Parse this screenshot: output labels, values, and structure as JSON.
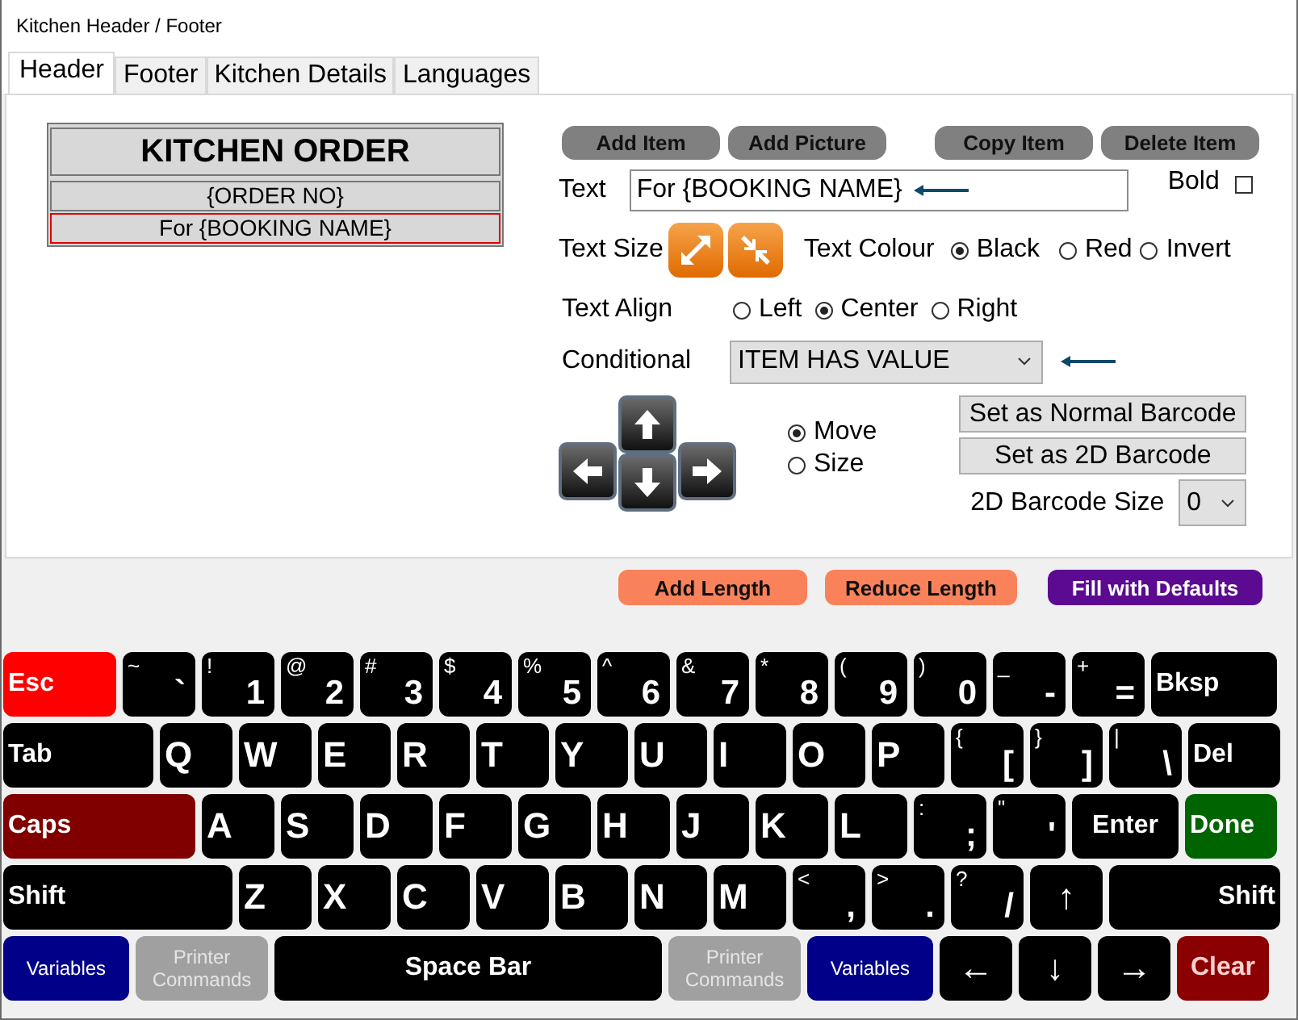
{
  "window": {
    "title": "Kitchen Header / Footer"
  },
  "tabs": [
    {
      "label": "Header",
      "selected": true
    },
    {
      "label": "Footer",
      "selected": false
    },
    {
      "label": "Kitchen Details",
      "selected": false
    },
    {
      "label": "Languages",
      "selected": false
    }
  ],
  "preview": {
    "lines": [
      {
        "text": "KITCHEN ORDER",
        "bold": true,
        "selected": false
      },
      {
        "text": "{ORDER NO}",
        "bold": false,
        "selected": false
      },
      {
        "text": "For {BOOKING NAME}",
        "bold": false,
        "selected": true
      }
    ]
  },
  "toolbar_buttons": [
    "Add Item",
    "Add Picture",
    "Copy Item",
    "Delete Item"
  ],
  "text_field": {
    "label": "Text",
    "value": "For {BOOKING NAME}"
  },
  "bold": {
    "label": "Bold",
    "checked": false
  },
  "text_size": {
    "label": "Text Size"
  },
  "text_colour": {
    "label": "Text Colour",
    "options": [
      {
        "label": "Black",
        "selected": true
      },
      {
        "label": "Red",
        "selected": false
      },
      {
        "label": "Invert",
        "selected": false
      }
    ]
  },
  "text_align": {
    "label": "Text Align",
    "options": [
      {
        "label": "Left",
        "selected": false
      },
      {
        "label": "Center",
        "selected": true
      },
      {
        "label": "Right",
        "selected": false
      }
    ]
  },
  "conditional": {
    "label": "Conditional",
    "value": "ITEM HAS VALUE"
  },
  "mode": {
    "options": [
      {
        "label": "Move",
        "selected": true
      },
      {
        "label": "Size",
        "selected": false
      }
    ]
  },
  "barcode_buttons": [
    "Set as Normal Barcode",
    "Set as 2D Barcode"
  ],
  "barcode_size": {
    "label": "2D Barcode Size",
    "value": "0"
  },
  "length_buttons": [
    {
      "label": "Add Length",
      "kind": "add"
    },
    {
      "label": "Reduce Length",
      "kind": "reduce"
    },
    {
      "label": "Fill with Defaults",
      "kind": "defaults"
    }
  ],
  "keyboard": {
    "rows": [
      {
        "keys": [
          {
            "label": "Esc",
            "kind": "esc"
          },
          {
            "label": "`",
            "shift": "~",
            "kind": "char"
          },
          {
            "label": "1",
            "shift": "!",
            "kind": "char"
          },
          {
            "label": "2",
            "shift": "@",
            "kind": "char"
          },
          {
            "label": "3",
            "shift": "#",
            "kind": "char"
          },
          {
            "label": "4",
            "shift": "$",
            "kind": "char"
          },
          {
            "label": "5",
            "shift": "%",
            "kind": "char"
          },
          {
            "label": "6",
            "shift": "^",
            "kind": "char"
          },
          {
            "label": "7",
            "shift": "&",
            "kind": "char"
          },
          {
            "label": "8",
            "shift": "*",
            "kind": "char"
          },
          {
            "label": "9",
            "shift": "(",
            "kind": "char"
          },
          {
            "label": "0",
            "shift": ")",
            "kind": "char"
          },
          {
            "label": "-",
            "shift": "_",
            "kind": "char"
          },
          {
            "label": "=",
            "shift": "+",
            "kind": "char"
          },
          {
            "label": "Bksp",
            "kind": "bksp"
          }
        ]
      },
      {
        "keys": [
          {
            "label": "Tab",
            "kind": "tab"
          },
          {
            "label": "Q",
            "kind": "letter"
          },
          {
            "label": "W",
            "kind": "letter"
          },
          {
            "label": "E",
            "kind": "letter"
          },
          {
            "label": "R",
            "kind": "letter"
          },
          {
            "label": "T",
            "kind": "letter"
          },
          {
            "label": "Y",
            "kind": "letter"
          },
          {
            "label": "U",
            "kind": "letter"
          },
          {
            "label": "I",
            "kind": "letter"
          },
          {
            "label": "O",
            "kind": "letter"
          },
          {
            "label": "P",
            "kind": "letter"
          },
          {
            "label": "[",
            "shift": "{",
            "kind": "char"
          },
          {
            "label": "]",
            "shift": "}",
            "kind": "char"
          },
          {
            "label": "\\",
            "shift": "|",
            "kind": "char"
          },
          {
            "label": "Del",
            "kind": "del"
          }
        ]
      },
      {
        "keys": [
          {
            "label": "Caps",
            "kind": "caps"
          },
          {
            "label": "A",
            "kind": "letter"
          },
          {
            "label": "S",
            "kind": "letter"
          },
          {
            "label": "D",
            "kind": "letter"
          },
          {
            "label": "F",
            "kind": "letter"
          },
          {
            "label": "G",
            "kind": "letter"
          },
          {
            "label": "H",
            "kind": "letter"
          },
          {
            "label": "J",
            "kind": "letter"
          },
          {
            "label": "K",
            "kind": "letter"
          },
          {
            "label": "L",
            "kind": "letter"
          },
          {
            "label": ";",
            "shift": ":",
            "kind": "char"
          },
          {
            "label": "'",
            "shift": "\"",
            "kind": "char"
          },
          {
            "label": "Enter",
            "kind": "enter"
          },
          {
            "label": "Done",
            "kind": "done"
          }
        ]
      },
      {
        "keys": [
          {
            "label": "Shift",
            "kind": "shift-left"
          },
          {
            "label": "Z",
            "kind": "letter"
          },
          {
            "label": "X",
            "kind": "letter"
          },
          {
            "label": "C",
            "kind": "letter"
          },
          {
            "label": "V",
            "kind": "letter"
          },
          {
            "label": "B",
            "kind": "letter"
          },
          {
            "label": "N",
            "kind": "letter"
          },
          {
            "label": "M",
            "kind": "letter"
          },
          {
            "label": ",",
            "shift": "<",
            "kind": "char"
          },
          {
            "label": ".",
            "shift": ">",
            "kind": "char"
          },
          {
            "label": "/",
            "shift": "?",
            "kind": "char"
          },
          {
            "label": "↑",
            "kind": "arrow"
          },
          {
            "label": "Shift",
            "kind": "shift-right"
          }
        ]
      },
      {
        "keys": [
          {
            "label": "Variables",
            "kind": "variables"
          },
          {
            "label": "Printer Commands",
            "kind": "printer"
          },
          {
            "label": "Space Bar",
            "kind": "space"
          },
          {
            "label": "Printer Commands",
            "kind": "printer"
          },
          {
            "label": "Variables",
            "kind": "variables"
          },
          {
            "label": "←",
            "kind": "arrow"
          },
          {
            "label": "↓",
            "kind": "arrow"
          },
          {
            "label": "→",
            "kind": "arrow"
          },
          {
            "label": "Clear",
            "kind": "clear"
          }
        ]
      }
    ]
  }
}
